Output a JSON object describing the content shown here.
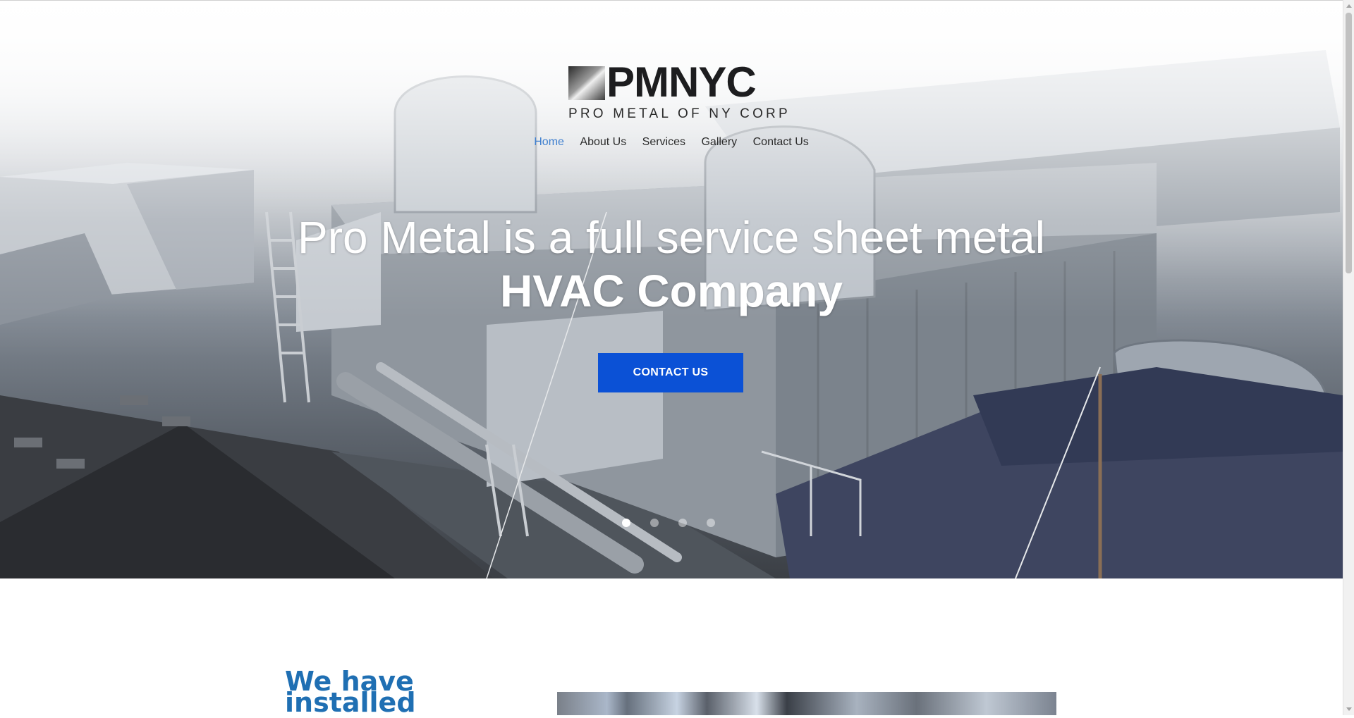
{
  "brand": {
    "name": "PMNYC",
    "tagline": "PRO METAL OF NY CORP"
  },
  "nav": {
    "items": [
      {
        "label": "Home",
        "active": true
      },
      {
        "label": "About Us",
        "active": false
      },
      {
        "label": "Services",
        "active": false
      },
      {
        "label": "Gallery",
        "active": false
      },
      {
        "label": "Contact Us",
        "active": false
      }
    ],
    "active_color": "#3f7fcf"
  },
  "hero": {
    "headline_line1": "Pro Metal is a full service sheet metal",
    "headline_line2": "HVAC Company",
    "cta_label": "CONTACT US",
    "cta_color": "#0b51d6",
    "slides": 4,
    "active_slide": 1
  },
  "intro": {
    "title_line1": "We have",
    "title_line2": "installed",
    "title_color": "#1f6fb3"
  }
}
